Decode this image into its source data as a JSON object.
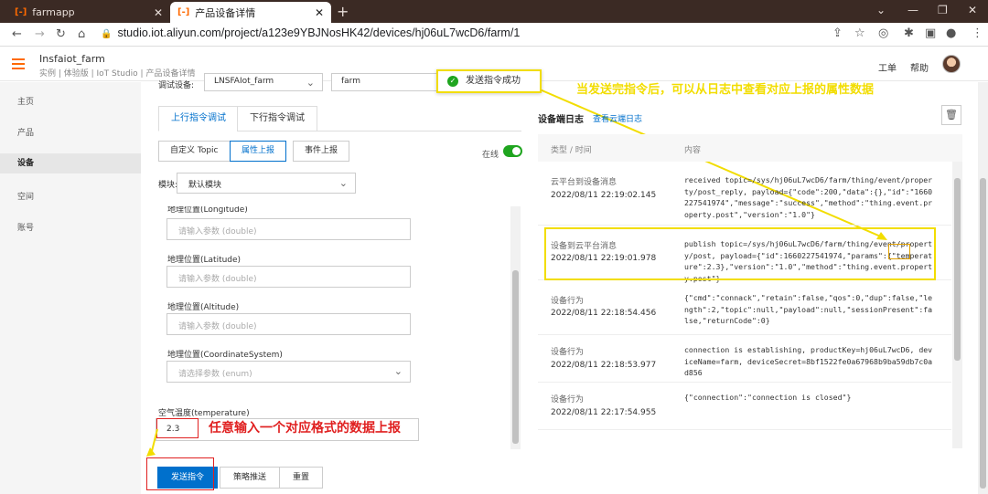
{
  "browser": {
    "tabs": [
      {
        "label": "farmapp",
        "icon": "aliyun-logo-icon"
      },
      {
        "label": "产品设备详情",
        "icon": "aliyun-logo-icon"
      }
    ],
    "url": "studio.iot.aliyun.com/project/a123e9YBJNosHK42/devices/hj06uL7wcD6/farm/1"
  },
  "header": {
    "project_name": "Insfaiot_farm",
    "breadcrumb": "实例 | 体验版 | IoT Studio | 产品设备详情",
    "links": [
      "工单",
      "帮助"
    ]
  },
  "sidebar": {
    "items": [
      {
        "label": "主页"
      },
      {
        "label": "产品"
      },
      {
        "label": "设备"
      },
      {
        "label": "空间"
      },
      {
        "label": "账号"
      }
    ],
    "active": "设备"
  },
  "debug": {
    "device_label": "调试设备:",
    "product_value": "LNSFAIot_farm",
    "device_value": "farm",
    "tabs": [
      "上行指令调试",
      "下行指令调试"
    ],
    "subtabs": [
      "自定义 Topic",
      "属性上报",
      "事件上报"
    ],
    "online_label": "在线",
    "module_label": "模块:",
    "module_value": "默认模块",
    "fields": [
      {
        "label": "地理位置(Longitude)",
        "placeholder": "请输入参数 (double)"
      },
      {
        "label": "地理位置(Latitude)",
        "placeholder": "请输入参数 (double)"
      },
      {
        "label": "地理位置(Altitude)",
        "placeholder": "请输入参数 (double)"
      },
      {
        "label": "地理位置(CoordinateSystem)",
        "placeholder": "请选择参数 (enum)"
      }
    ],
    "temperature_label": "空气温度(temperature)",
    "temperature_value": "2.3",
    "buttons": [
      "发送指令",
      "策略推送",
      "重置"
    ]
  },
  "log": {
    "title": "设备端日志",
    "link": "查看云端日志",
    "col_type": "类型 / 时间",
    "col_content": "内容",
    "rows": [
      {
        "type": "云平台到设备消息",
        "time": "2022/08/11 22:19:02.145",
        "content": "received topic=/sys/hj06uL7wcD6/farm/thing/event/property/post_reply, payload={\"code\":200,\"data\":{},\"id\":\"1660227541974\",\"message\":\"success\",\"method\":\"thing.event.property.post\",\"version\":\"1.0\"}"
      },
      {
        "type": "设备到云平台消息",
        "time": "2022/08/11 22:19:01.978",
        "content": "publish topic=/sys/hj06uL7wcD6/farm/thing/event/property/post, payload={\"id\":1660227541974,\"params\":{\"temperature\":2.3},\"version\":\"1.0\",\"method\":\"thing.event.property.post\"}"
      },
      {
        "type": "设备行为",
        "time": "2022/08/11 22:18:54.456",
        "content": "{\"cmd\":\"connack\",\"retain\":false,\"qos\":0,\"dup\":false,\"length\":2,\"topic\":null,\"payload\":null,\"sessionPresent\":false,\"returnCode\":0}"
      },
      {
        "type": "设备行为",
        "time": "2022/08/11 22:18:53.977",
        "content": "connection is establishing, productKey=hj06uL7wcD6, deviceName=farm, deviceSecret=8bf1522fe0a67968b9ba59db7c0ad856"
      },
      {
        "type": "设备行为",
        "time": "2022/08/11 22:17:54.955",
        "content": "{\"connection\":\"connection is closed\"}"
      }
    ]
  },
  "toast": "发送指令成功",
  "annotations": {
    "yellow": "当发送完指令后，可以从日志中查看对应上报的属性数据",
    "red": "任意输入一个对应格式的数据上报"
  },
  "colors": {
    "accent": "#0070cc",
    "brand": "#ff6a00",
    "highlight": "#f2dd00",
    "annotation_red": "#e02020",
    "success": "#1fa51f"
  }
}
